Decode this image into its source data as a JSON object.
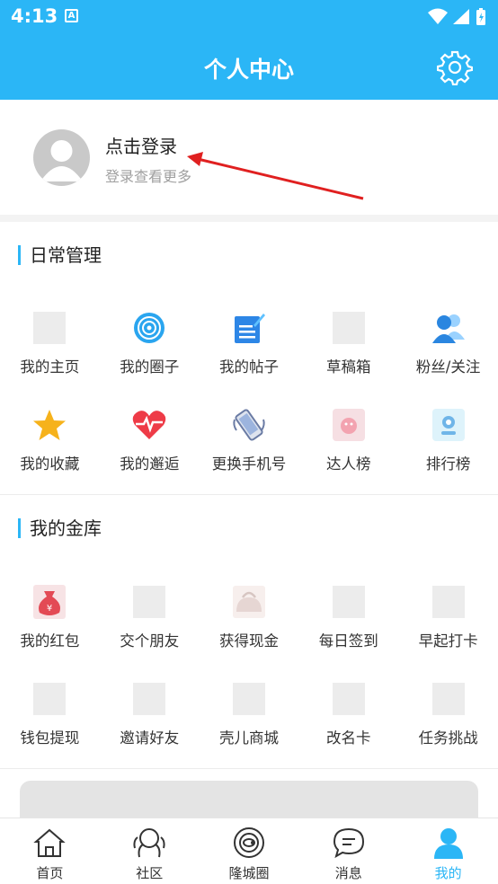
{
  "status": {
    "time": "4:13",
    "notif_letter": "A"
  },
  "header": {
    "title": "个人中心",
    "settings_icon": "gear-icon"
  },
  "profile": {
    "title": "点击登录",
    "subtitle": "登录查看更多"
  },
  "sections": [
    {
      "title": "日常管理",
      "items": [
        {
          "label": "我的主页",
          "icon": "placeholder"
        },
        {
          "label": "我的圈子",
          "icon": "circle-target-icon"
        },
        {
          "label": "我的帖子",
          "icon": "post-edit-icon"
        },
        {
          "label": "草稿箱",
          "icon": "placeholder"
        },
        {
          "label": "粉丝/关注",
          "icon": "fans-icon"
        },
        {
          "label": "我的收藏",
          "icon": "star-icon"
        },
        {
          "label": "我的邂逅",
          "icon": "heart-pulse-icon"
        },
        {
          "label": "更换手机号",
          "icon": "phone-icon"
        },
        {
          "label": "达人榜",
          "icon": "expert-icon"
        },
        {
          "label": "排行榜",
          "icon": "ranking-icon"
        }
      ]
    },
    {
      "title": "我的金库",
      "items": [
        {
          "label": "我的红包",
          "icon": "money-bag-icon"
        },
        {
          "label": "交个朋友",
          "icon": "placeholder"
        },
        {
          "label": "获得现金",
          "icon": "purse-icon"
        },
        {
          "label": "每日签到",
          "icon": "placeholder"
        },
        {
          "label": "早起打卡",
          "icon": "placeholder"
        },
        {
          "label": "钱包提现",
          "icon": "placeholder"
        },
        {
          "label": "邀请好友",
          "icon": "placeholder"
        },
        {
          "label": "壳儿商城",
          "icon": "placeholder"
        },
        {
          "label": "改名卡",
          "icon": "placeholder"
        },
        {
          "label": "任务挑战",
          "icon": "placeholder"
        }
      ]
    }
  ],
  "bottom_nav": [
    {
      "label": "首页",
      "icon": "home-icon",
      "active": false
    },
    {
      "label": "社区",
      "icon": "community-icon",
      "active": false
    },
    {
      "label": "隆城圈",
      "icon": "planet-icon",
      "active": false
    },
    {
      "label": "消息",
      "icon": "message-icon",
      "active": false
    },
    {
      "label": "我的",
      "icon": "user-icon",
      "active": true
    }
  ],
  "colors": {
    "primary": "#2bb6f6",
    "arrow": "#e02020"
  }
}
